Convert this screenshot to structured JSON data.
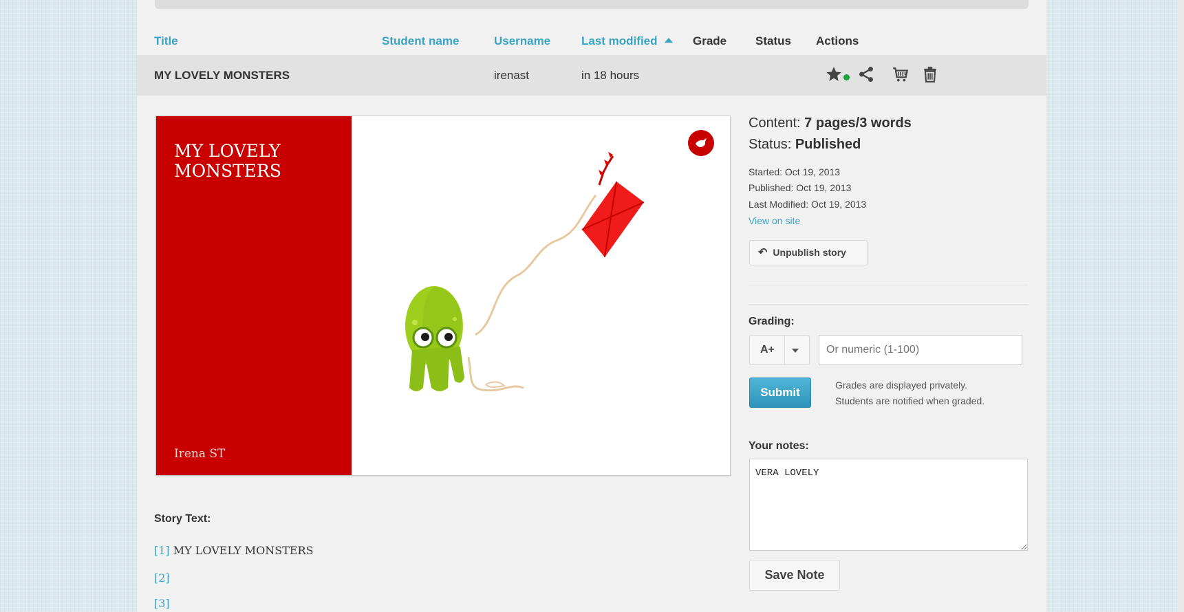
{
  "table": {
    "headers": {
      "title": "Title",
      "student_name": "Student name",
      "username": "Username",
      "last_modified": "Last modified",
      "grade": "Grade",
      "status": "Status",
      "actions": "Actions"
    },
    "row": {
      "title": "MY LOVELY MONSTERS",
      "student_name": "",
      "username": "irenast",
      "last_modified": "in 18 hours",
      "status_color": "#1aa33b"
    }
  },
  "actions": {
    "icons": [
      "star-icon",
      "share-icon",
      "cart-icon",
      "trash-icon"
    ]
  },
  "cover": {
    "title": "MY LOVELY MONSTERS",
    "author": "Irena ST",
    "accent_color": "#c80000"
  },
  "details": {
    "content_label": "Content: ",
    "content_value": "7 pages/3 words",
    "status_label": "Status: ",
    "status_value": "Published",
    "started": "Started: Oct 19, 2013",
    "published": "Published: Oct 19, 2013",
    "last_modified": "Last Modified: Oct 19, 2013",
    "view_link": "View on site",
    "unpublish_label": "Unpublish story"
  },
  "grading": {
    "label": "Grading:",
    "letter_grade": "A+",
    "numeric_placeholder": "Or numeric (1-100)",
    "submit_label": "Submit",
    "note_line1": "Grades are displayed privately.",
    "note_line2": "Students are notified when graded."
  },
  "notes": {
    "label": "Your notes:",
    "value": "VERA LOVELY",
    "save_label": "Save Note"
  },
  "story_text": {
    "label": "Story Text:",
    "lines": [
      {
        "num": "[1]",
        "text": " MY LOVELY MONSTERS"
      },
      {
        "num": "[2]",
        "text": ""
      },
      {
        "num": "[3]",
        "text": ""
      }
    ]
  }
}
